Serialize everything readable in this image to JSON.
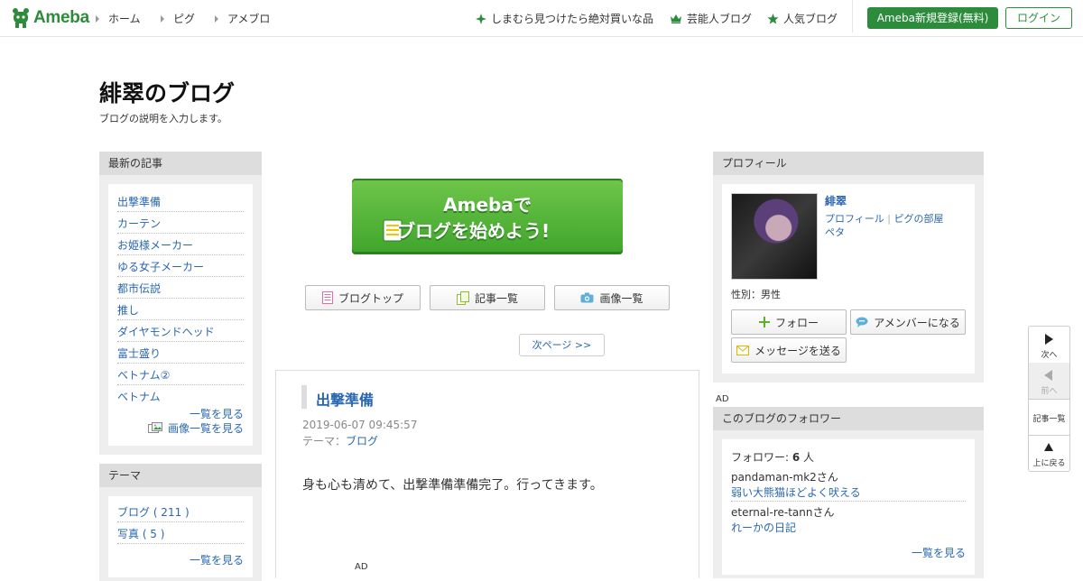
{
  "header": {
    "logo_text": "Ameba",
    "nav": [
      "ホーム",
      "ピグ",
      "アメブロ"
    ],
    "right_links": [
      {
        "label": "しまむら見つけたら絶対買いな品",
        "icon": "diamond-star-icon"
      },
      {
        "label": "芸能人ブログ",
        "icon": "crown-icon"
      },
      {
        "label": "人気ブログ",
        "icon": "star-icon"
      }
    ],
    "register": "Ameba新規登録(無料)",
    "login": "ログイン",
    "accent": "#2d8c3c"
  },
  "blog": {
    "title": "緋翠のブログ",
    "description": "ブログの説明を入力します。"
  },
  "latest": {
    "heading": "最新の記事",
    "items": [
      "出撃準備",
      "カーテン",
      "お姫様メーカー",
      "ゆる女子メーカー",
      "都市伝説",
      "推し",
      "ダイヤモンドヘッド",
      "富士盛り",
      "ベトナム②",
      "ベトナム"
    ],
    "see_all": "一覧を見る",
    "see_images": "画像一覧を見る"
  },
  "theme": {
    "heading": "テーマ",
    "items": [
      "ブログ ( 211 )",
      "写真 ( 5 )"
    ],
    "see_all": "一覧を見る"
  },
  "banner": {
    "line1": "Amebaで",
    "line2": "ブログを始めよう!"
  },
  "center_buttons": [
    "ブログトップ",
    "記事一覧",
    "画像一覧"
  ],
  "pager": {
    "next": "次ページ >>"
  },
  "article": {
    "title": "出撃準備",
    "date": "2019-06-07 09:45:57",
    "theme_label": "テーマ：",
    "theme_link": "ブログ",
    "body": "身も心も清めて、出撃準備準備完了。行ってきます。",
    "ad": "AD"
  },
  "profile": {
    "heading": "プロフィール",
    "name": "緋翠",
    "link_profile": "プロフィール",
    "separator": "|",
    "link_pig": "ピグの部屋",
    "link_peta": "ペタ",
    "gender": "性別：男性",
    "follow": "フォロー",
    "amember": "アメンバーになる",
    "message": "メッセージを送る"
  },
  "ad_label": "AD",
  "followers": {
    "heading": "このブログのフォロワー",
    "count_label": "フォロワー: ",
    "count": "6",
    "count_unit": " 人",
    "entries": [
      {
        "user": "pandaman-mk2さん",
        "blog": "弱い大熊猫ほどよく吠える"
      },
      {
        "user": "eternal-re-tannさん",
        "blog": "れーかの日記"
      }
    ],
    "see_all": "一覧を見る"
  },
  "float_nav": {
    "next": "次へ",
    "prev": "前へ",
    "list": "記事一覧",
    "top": "上に戻る"
  }
}
